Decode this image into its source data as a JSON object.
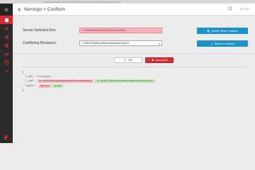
{
  "browser": {
    "url": "localhost:5984/_utils/fauxton/#/database/animaldb/flamingo/conflicts"
  },
  "header": {
    "db": "flamingo",
    "separator": ">",
    "page": "Conflicts",
    "api_label": "API"
  },
  "form": {
    "server_rev_label": "Server-Selected Rev:",
    "server_rev_value": "2-c0f9fb5bd6b4a6da3f090f1ceed5b814",
    "conflicting_label": "Conflicting Revisions:",
    "conflicting_value": "2-9f9f27406f8cbcb68c4bd5e5afcd13ea7d",
    "delete_button": "Delete Other Conflicts",
    "select_winner_button": "Select as Winner"
  },
  "tabs": {
    "diff": "Diff",
    "document": "Document"
  },
  "document": {
    "id_key": "\"_id\"",
    "id_value": "\"flamingo\"",
    "rev_key": "\"_rev\"",
    "rev_old": "\"2-c0f9fb5bd6b4a6da3f090f1ceed5b814\"",
    "rev_new": "\"2-9f9f27406f8cbcb68c4bd5e5afcd13ea7d\"",
    "color_key": "\"color\"",
    "color_old": "\"white\"",
    "color_new": "\"pink\""
  },
  "colors": {
    "accent": "#d82b33",
    "button_blue": "#1c92c8",
    "sidebar": "#2b2b2b"
  }
}
